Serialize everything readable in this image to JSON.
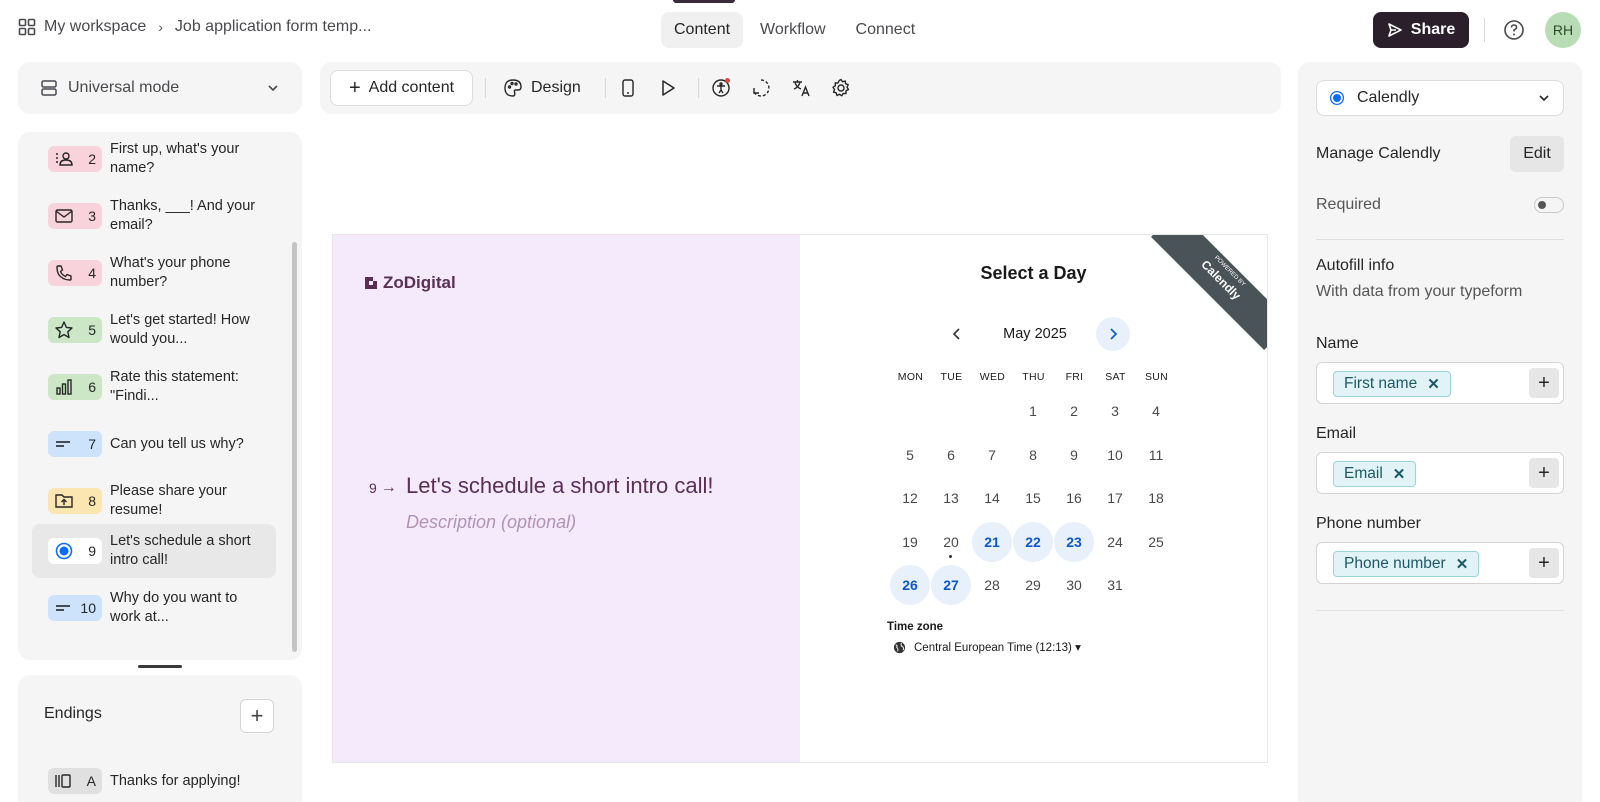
{
  "breadcrumb": {
    "workspace": "My workspace",
    "separator": "›",
    "form_name": "Job application form temp..."
  },
  "tabs": [
    {
      "label": "Content"
    },
    {
      "label": "Workflow"
    },
    {
      "label": "Connect"
    }
  ],
  "header": {
    "share_label": "Share",
    "avatar_initials": "RH"
  },
  "mode_selector": {
    "label": "Universal mode"
  },
  "questions": [
    {
      "num": "2",
      "text": "First up, what's your name?",
      "color": "#f9d3dc",
      "icon": "contact-icon"
    },
    {
      "num": "3",
      "text": "Thanks, ___! And your email?",
      "color": "#f9d3dc",
      "icon": "email-icon"
    },
    {
      "num": "4",
      "text": "What's your phone number?",
      "color": "#f9d3dc",
      "icon": "phone-icon"
    },
    {
      "num": "5",
      "text": "Let's get started! How would you...",
      "color": "#cbe7c6",
      "icon": "star-icon"
    },
    {
      "num": "6",
      "text": "Rate this statement: \"Findi...",
      "color": "#cbe7c6",
      "icon": "bar-chart-icon"
    },
    {
      "num": "7",
      "text": "Can you tell us why?",
      "color": "#cde3fb",
      "icon": "long-text-icon"
    },
    {
      "num": "8",
      "text": "Please share your resume!",
      "color": "#fbe6b1",
      "icon": "file-upload-icon"
    },
    {
      "num": "9",
      "text": "Let's schedule a short intro call!",
      "color": "#ffffff",
      "icon": "calendly-icon"
    },
    {
      "num": "10",
      "text": "Why do you want to work at...",
      "color": "#cde3fb",
      "icon": "long-text-icon"
    }
  ],
  "endings": {
    "title": "Endings",
    "add_label": "+",
    "items": [
      {
        "letter": "A",
        "text": "Thanks for applying!"
      }
    ]
  },
  "toolbar": {
    "add_content_label": "Add content",
    "design_label": "Design"
  },
  "canvas": {
    "brand": "ZoDigital",
    "question_number": "9",
    "question_arrow": "→",
    "question_title": "Let's schedule a short intro call!",
    "description_placeholder": "Description (optional)",
    "calendly": {
      "ribbon_small": "POWERED BY",
      "ribbon_brand": "Calendly",
      "title": "Select a Day",
      "month": "May 2025",
      "weekdays": [
        "MON",
        "TUE",
        "WED",
        "THU",
        "FRI",
        "SAT",
        "SUN"
      ],
      "days": [
        [
          "",
          "",
          "",
          "1",
          "2",
          "3",
          "4"
        ],
        [
          "5",
          "6",
          "7",
          "8",
          "9",
          "10",
          "11"
        ],
        [
          "12",
          "13",
          "14",
          "15",
          "16",
          "17",
          "18"
        ],
        [
          "19",
          "20",
          "21",
          "22",
          "23",
          "24",
          "25"
        ],
        [
          "26",
          "27",
          "28",
          "29",
          "30",
          "31",
          ""
        ]
      ],
      "available_days": [
        "21",
        "22",
        "23",
        "26",
        "27"
      ],
      "today": "20",
      "timezone_label": "Time zone",
      "timezone_value": "Central European Time (12:13) ▾"
    }
  },
  "right_panel": {
    "block_type": "Calendly",
    "manage_label": "Manage Calendly",
    "edit_label": "Edit",
    "required_label": "Required",
    "required": false,
    "autofill_title": "Autofill info",
    "autofill_subtitle": "With data from your typeform",
    "fields": [
      {
        "label": "Name",
        "chip": "First name"
      },
      {
        "label": "Email",
        "chip": "Email"
      },
      {
        "label": "Phone number",
        "chip": "Phone number"
      }
    ]
  },
  "colors": {
    "brand_dark": "#2a1f2a",
    "canvas_bg": "#f4eafb",
    "question_text": "#5a2f55",
    "calendly_blue": "#0a58ca"
  }
}
